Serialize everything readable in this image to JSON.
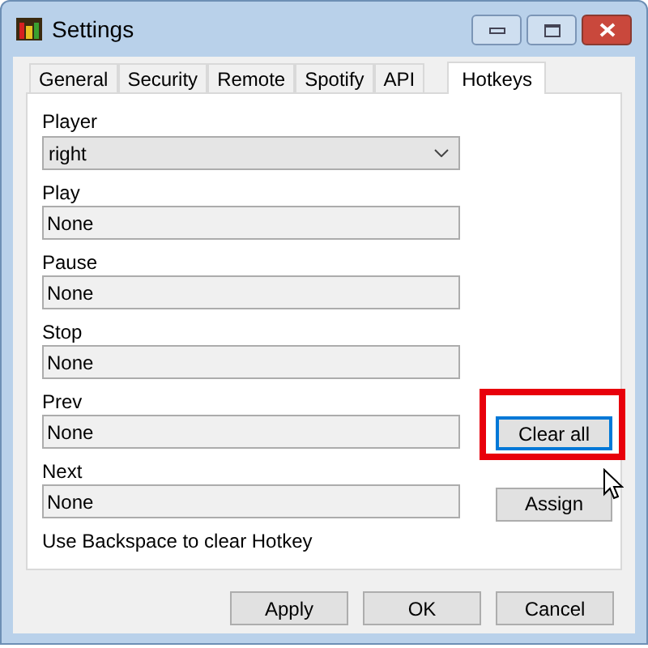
{
  "window": {
    "title": "Settings"
  },
  "tabs": [
    {
      "label": "General",
      "selected": false
    },
    {
      "label": "Security",
      "selected": false
    },
    {
      "label": "Remote",
      "selected": false
    },
    {
      "label": "Spotify",
      "selected": false
    },
    {
      "label": "API",
      "selected": false
    },
    {
      "label": "Hotkeys",
      "selected": true
    }
  ],
  "player": {
    "label": "Player",
    "value": "right"
  },
  "hotkeys": [
    {
      "label": "Play",
      "value": "None"
    },
    {
      "label": "Pause",
      "value": "None"
    },
    {
      "label": "Stop",
      "value": "None"
    },
    {
      "label": "Prev",
      "value": "None",
      "action": {
        "label": "Clear all",
        "focused": true,
        "highlighted": true
      }
    },
    {
      "label": "Next",
      "value": "None",
      "action": {
        "label": "Assign",
        "focused": false,
        "highlighted": false
      }
    }
  ],
  "hint": "Use Backspace to clear Hotkey",
  "footer_buttons": [
    "Apply",
    "OK",
    "Cancel"
  ]
}
